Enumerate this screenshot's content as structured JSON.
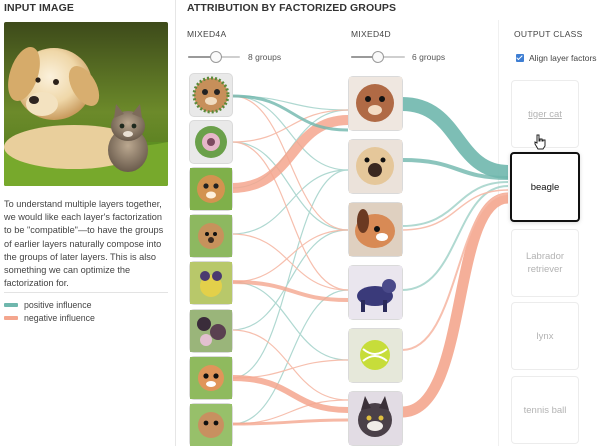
{
  "sections": {
    "input": "INPUT IMAGE",
    "attribution": "ATTRIBUTION BY FACTORIZED GROUPS"
  },
  "description": "To understand multiple layers together, we would like each layer's factorization to be \"compatible\"—to have the groups of earlier layers naturally compose into the groups of later layers. This is also something we can optimize the factorization for.",
  "legend": [
    {
      "label": "positive influence",
      "color": "#6fb7ad"
    },
    {
      "label": "negative influence",
      "color": "#f4a68e"
    }
  ],
  "layers": [
    {
      "name": "MIXED4A",
      "slider_label": "8 groups",
      "slider_value_fraction": 0.55
    },
    {
      "name": "MIXED4D",
      "slider_label": "6 groups",
      "slider_value_fraction": 0.5
    }
  ],
  "output": {
    "title": "OUTPUT CLASS",
    "align_label": "Align layer factors",
    "align_checked": true,
    "classes": [
      {
        "label": "tiger cat",
        "state": "hover"
      },
      {
        "label": "beagle",
        "state": "selected"
      },
      {
        "label": "Labrador retriever",
        "state": "normal"
      },
      {
        "label": "lynx",
        "state": "normal"
      },
      {
        "label": "tennis ball",
        "state": "normal"
      }
    ]
  },
  "colors": {
    "positive": "#6fb7ad",
    "negative": "#f4a68e",
    "accent": "#3e7ed3"
  },
  "icons": {
    "layer4a_groups": [
      "dog-face",
      "flower-pattern",
      "beagle-face",
      "puppy-face",
      "yellow-flower",
      "dark-pattern",
      "colorful-pattern",
      "puppy-face"
    ],
    "layer4d_groups": [
      "dog-face",
      "dog-snout",
      "dog-ear",
      "dog-body",
      "tennis-ball",
      "lynx-face"
    ]
  }
}
